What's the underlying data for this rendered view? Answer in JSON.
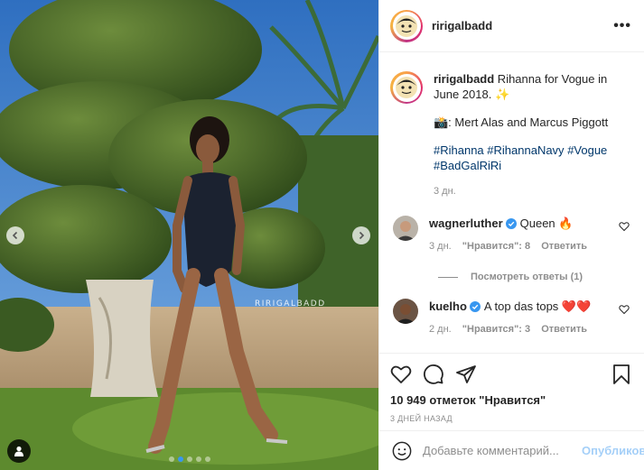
{
  "photo": {
    "watermark": "RIRIGALBADD",
    "slide_index": 1,
    "slide_count": 5
  },
  "header": {
    "username": "ririgalbadd",
    "more_label": "•••"
  },
  "caption": {
    "username": "ririgalbadd",
    "text": " Rihanna for Vogue in June 2018. ✨",
    "credit": "📸: Mert Alas and Marcus Piggott",
    "hashtags": [
      "#Rihanna",
      "#RihannaNavy",
      "#Vogue",
      "#BadGalRiRi"
    ],
    "time": "3 дн."
  },
  "comments": [
    {
      "username": "wagnerluther",
      "verified": true,
      "text": "Queen 🔥",
      "time": "3 дн.",
      "likes": "\"Нравится\": 8",
      "reply": "Ответить",
      "view_replies": "Посмотреть ответы (1)"
    },
    {
      "username": "kuelho",
      "verified": true,
      "text": "A top das tops ❤️❤️",
      "time": "2 дн.",
      "likes": "\"Нравится\": 3",
      "reply": "Ответить"
    }
  ],
  "actions": {
    "likes": "10 949 отметок \"Нравится\"",
    "date": "3 ДНЕЙ НАЗАД"
  },
  "add_comment": {
    "placeholder": "Добавьте комментарий...",
    "publish": "Опубликовать"
  },
  "colors": {
    "link": "#00376b",
    "accent": "#3897f0",
    "verified": "#3897f0",
    "secondary_text": "#8e8e8e"
  }
}
